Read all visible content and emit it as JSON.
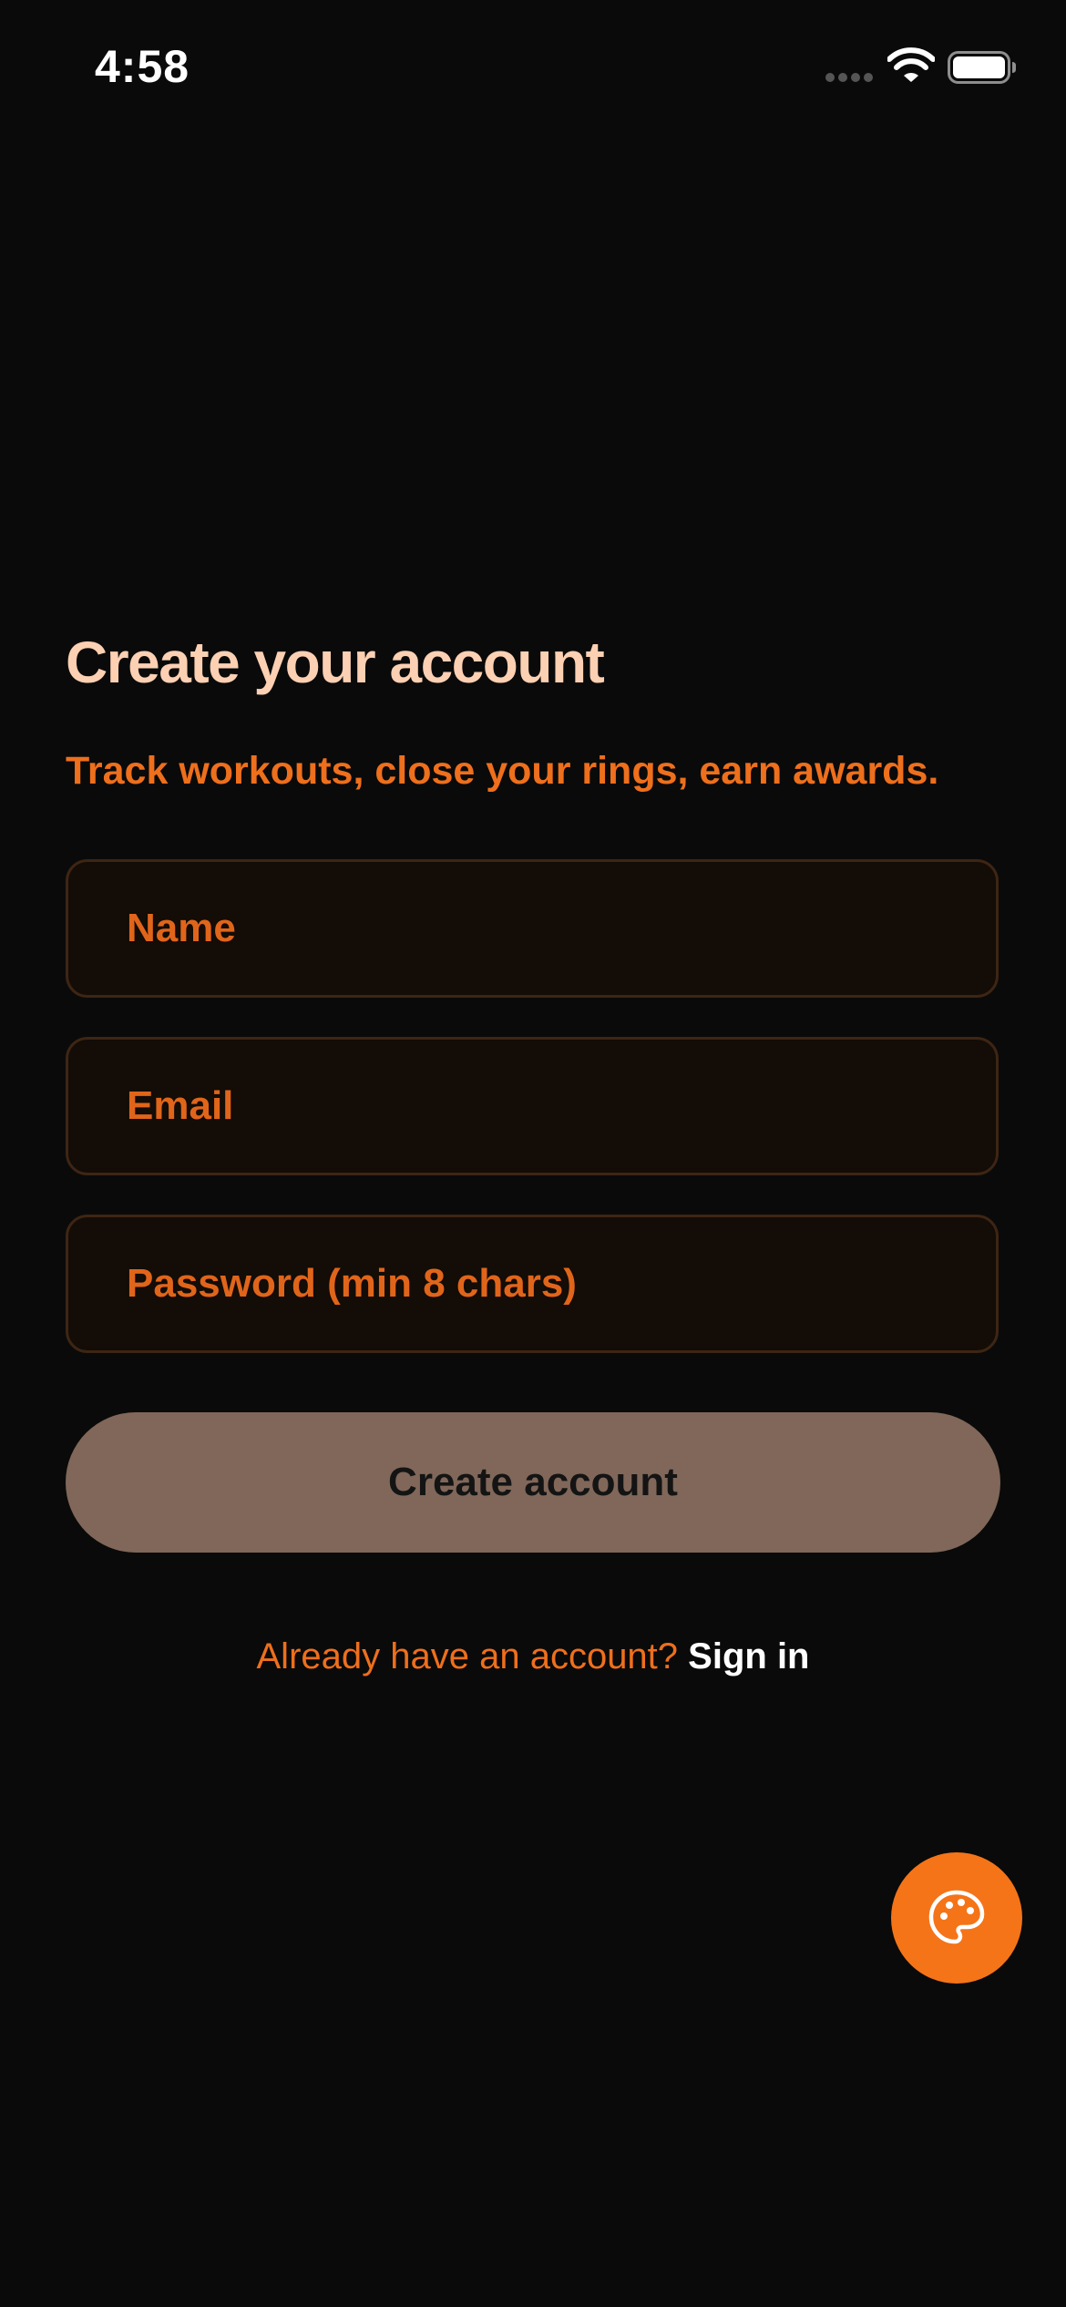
{
  "status_bar": {
    "time": "4:58",
    "icons": [
      "signal-dots-icon",
      "wifi-icon",
      "battery-icon"
    ]
  },
  "header": {
    "title": "Create your account",
    "subtitle": "Track workouts, close your rings, earn awards."
  },
  "form": {
    "name_placeholder": "Name",
    "name_value": "",
    "email_placeholder": "Email",
    "email_value": "",
    "password_placeholder": "Password (min 8 chars)",
    "password_value": "",
    "submit_label": "Create account"
  },
  "footer": {
    "prompt": "Already have an account?",
    "signin_label": "Sign in"
  },
  "fab": {
    "icon": "palette-icon"
  },
  "colors": {
    "background": "#0a0a0a",
    "title": "#fcd0b2",
    "accent": "#ee6f1c",
    "field_border": "#3e2513",
    "field_background": "#130c07",
    "button_disabled": "#806759",
    "fab": "#f57418"
  }
}
